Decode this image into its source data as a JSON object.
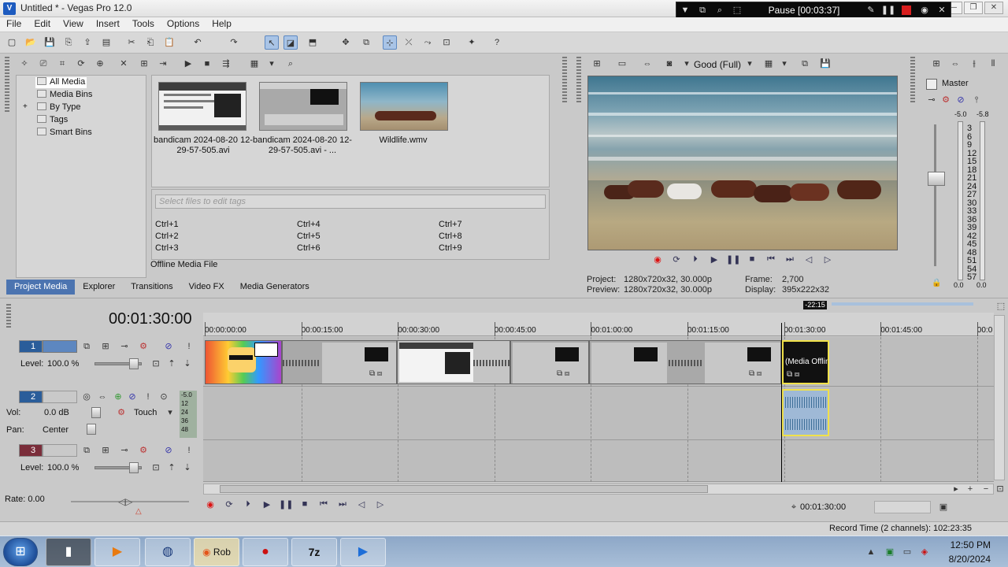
{
  "window": {
    "title": "Untitled * - Vegas Pro 12.0"
  },
  "recorder": {
    "status": "Pause [00:03:37]"
  },
  "menu": [
    "File",
    "Edit",
    "View",
    "Insert",
    "Tools",
    "Options",
    "Help"
  ],
  "media_tree": [
    "All Media",
    "Media Bins",
    "By Type",
    "Tags",
    "Smart Bins"
  ],
  "media_files": [
    {
      "label": "bandicam 2024-08-20 12-29-57-505.avi"
    },
    {
      "label": "bandicam 2024-08-20 12-29-57-505.avi - ..."
    },
    {
      "label": "Wildlife.wmv"
    }
  ],
  "tags": {
    "placeholder": "Select files to edit tags",
    "shortcuts": [
      "Ctrl+1",
      "Ctrl+2",
      "Ctrl+3",
      "Ctrl+4",
      "Ctrl+5",
      "Ctrl+6",
      "Ctrl+7",
      "Ctrl+8",
      "Ctrl+9"
    ]
  },
  "media_status": "Offline Media File",
  "dock_tabs": [
    "Project Media",
    "Explorer",
    "Transitions",
    "Video FX",
    "Media Generators"
  ],
  "preview": {
    "quality": "Good (Full)",
    "project_label": "Project:",
    "project_value": "1280x720x32, 30.000p",
    "preview_label": "Preview:",
    "preview_value": "1280x720x32, 30.000p",
    "frame_label": "Frame:",
    "frame_value": "2,700",
    "display_label": "Display:",
    "display_value": "395x222x32"
  },
  "master": {
    "label": "Master",
    "peak_left": "-5.0",
    "peak_right": "-5.8",
    "scale": [
      "3",
      "6",
      "9",
      "12",
      "15",
      "18",
      "21",
      "24",
      "27",
      "30",
      "33",
      "36",
      "39",
      "42",
      "45",
      "48",
      "51",
      "54",
      "57"
    ],
    "bottom_left": "0.0",
    "bottom_right": "0.0"
  },
  "timeline": {
    "time": "00:01:30:00",
    "end_marker": "-22:15",
    "ruler": [
      "00:00:00:00",
      "00:00:15:00",
      "00:00:30:00",
      "00:00:45:00",
      "00:01:00:00",
      "00:01:15:00",
      "00:01:30:00",
      "00:01:45:00",
      "00:0"
    ],
    "tracks": [
      {
        "num": "1",
        "level_label": "Level:",
        "level_value": "100.0 %"
      },
      {
        "num": "2",
        "vol_label": "Vol:",
        "vol_value": "0.0 dB",
        "touch": "Touch",
        "pan_label": "Pan:",
        "pan_value": "Center",
        "meter": [
          "-5.0",
          "12",
          "24",
          "36",
          "48"
        ]
      },
      {
        "num": "3",
        "level_label": "Level:",
        "level_value": "100.0 %"
      }
    ],
    "offline_clip": "(Media Offline)",
    "rate": "Rate: 0.00",
    "cursor_time": "00:01:30:00"
  },
  "status": {
    "record_time": "Record Time (2 channels): 102:23:35"
  },
  "taskbar": {
    "firefox_label": "Rob",
    "clock_time": "12:50 PM",
    "clock_date": "8/20/2024"
  }
}
